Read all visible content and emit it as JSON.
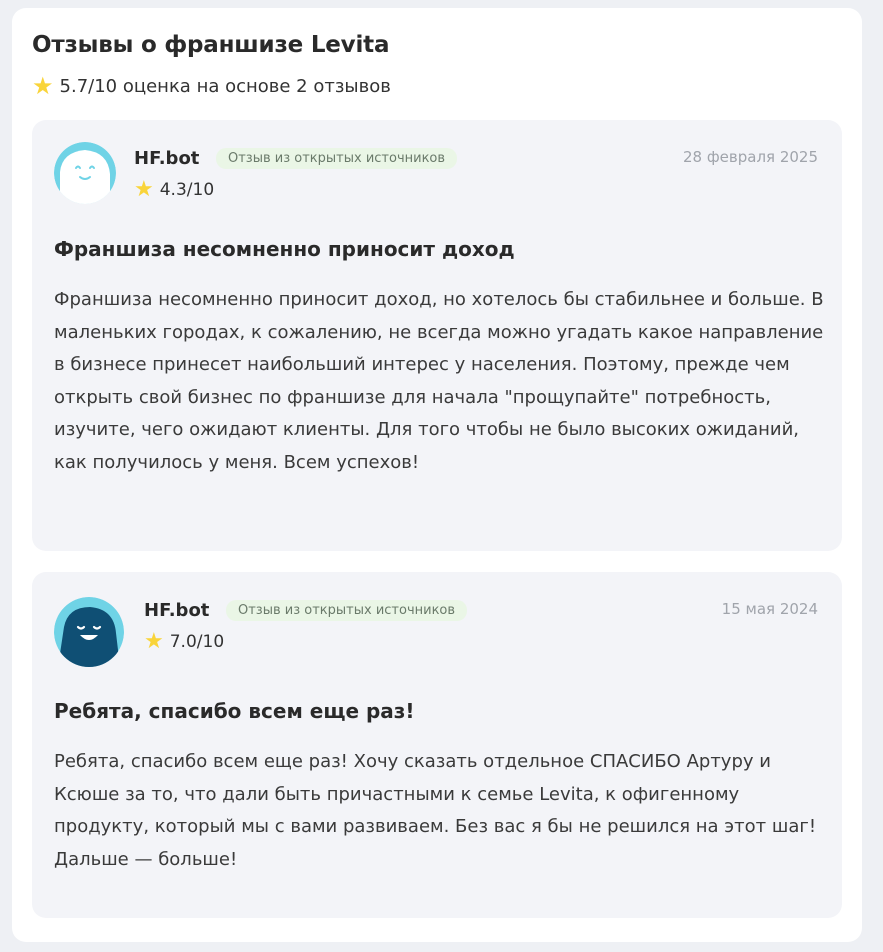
{
  "page": {
    "title": "Отзывы о франшизе Levita",
    "summary": "5.7/10 оценка на основе 2 отзывов"
  },
  "colors": {
    "star": "#f9d43a",
    "card_bg": "#ffffff",
    "review_bg": "#f3f4f8",
    "badge_bg": "#eaf6e6",
    "avatar_light": "#6fd3e6",
    "avatar_dark": "#0f4f74"
  },
  "reviews": [
    {
      "author": "HF.bot",
      "badge": "Отзыв из открытых источников",
      "date": "28 февраля 2025",
      "rating": "4.3/10",
      "avatar_icon": "happy-bot-light-icon",
      "title": "Франшиза несомненно приносит доход",
      "text": "Франшиза несомненно приносит доход, но хотелось бы стабильнее и больше. В маленьких городах, к сожалению, не всегда можно угадать какое направление в бизнесе принесет наибольший интерес у населения. Поэтому, прежде чем открыть свой бизнес по франшизе для начала \"прощупайте\" потребность, изучите, чего ожидают клиенты. Для того чтобы не было высоких ожиданий, как получилось у меня. Всем успехов!"
    },
    {
      "author": "HF.bot",
      "badge": "Отзыв из открытых источников",
      "date": "15 мая 2024",
      "rating": "7.0/10",
      "avatar_icon": "happy-bot-dark-icon",
      "title": "Ребята, спасибо всем еще раз!",
      "text": "Ребята, спасибо всем еще раз! Хочу сказать отдельное СПАСИБО Артуру и Ксюше за то, что дали быть причастными к семье Levita, к офигенному продукту, который мы с вами развиваем. Без вас я бы не решился на этот шаг! Дальше — больше!"
    }
  ]
}
